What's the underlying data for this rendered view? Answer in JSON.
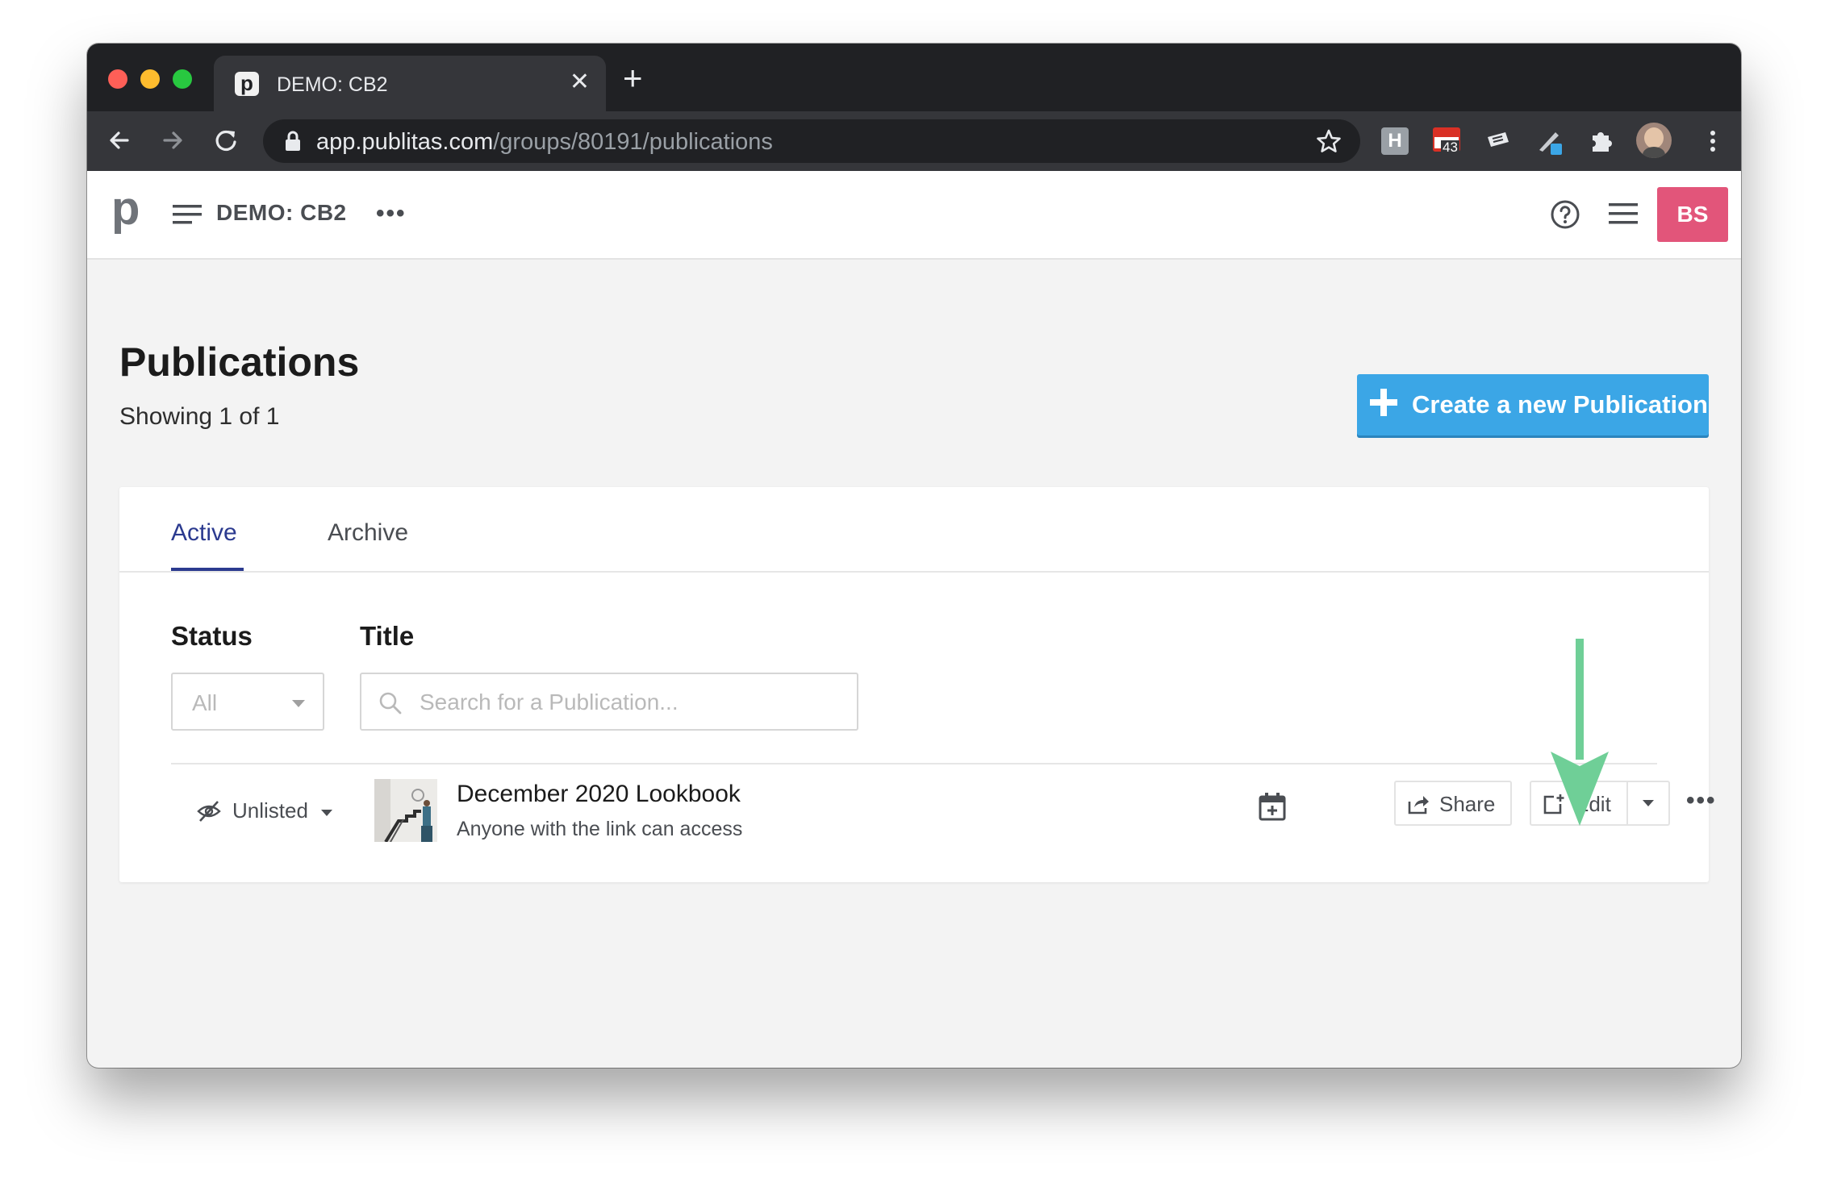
{
  "browser": {
    "tab_title": "DEMO: CB2",
    "favicon_letter": "p",
    "url_host": "app.publitas.com",
    "url_path": "/groups/80191/publications",
    "extension_badge": "43",
    "extension_h": "H"
  },
  "header": {
    "logo": "p",
    "group_name": "DEMO: CB2",
    "more": "•••",
    "user_initials": "BS"
  },
  "page": {
    "title": "Publications",
    "subtitle": "Showing 1 of 1",
    "create_label": "Create a new Publication"
  },
  "tabs": [
    {
      "label": "Active",
      "active": true
    },
    {
      "label": "Archive",
      "active": false
    }
  ],
  "filters": {
    "status_label": "Status",
    "status_value": "All",
    "title_label": "Title",
    "title_placeholder": "Search for a Publication..."
  },
  "publications": [
    {
      "visibility": "Unlisted",
      "title": "December 2020 Lookbook",
      "access": "Anyone with the link can access",
      "share_label": "Share",
      "edit_label": "Edit",
      "more": "•••"
    }
  ],
  "colors": {
    "accent": "#3ba6e6",
    "tab_active": "#2b3a8f",
    "avatar": "#e2557a",
    "annotation_arrow": "#6fcf97"
  }
}
